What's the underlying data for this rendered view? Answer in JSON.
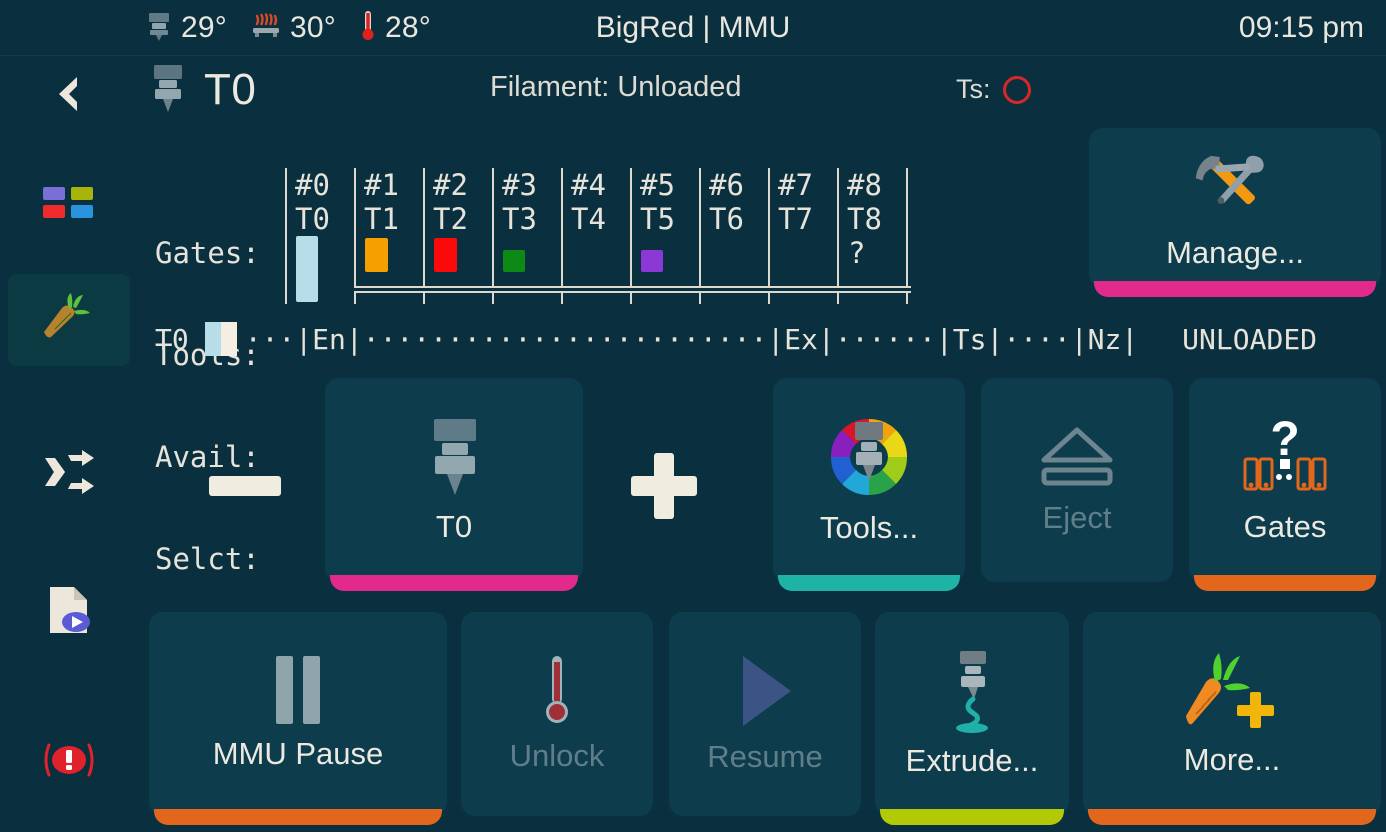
{
  "statusbar": {
    "temps": [
      {
        "icon": "nozzle-icon",
        "value": "29°"
      },
      {
        "icon": "bed-heater-icon",
        "value": "30°"
      },
      {
        "icon": "thermometer-icon",
        "value": "28°"
      }
    ],
    "title": "BigRed | MMU",
    "clock": "09:15 pm"
  },
  "sidebar": {
    "items": [
      {
        "name": "back",
        "icon": "chevron-left-icon",
        "active": false
      },
      {
        "name": "tools",
        "icon": "color-squares-icon",
        "active": false
      },
      {
        "name": "mmu",
        "icon": "carrot-icon",
        "active": true
      },
      {
        "name": "shuffle",
        "icon": "shuffle-icon",
        "active": false
      },
      {
        "name": "print",
        "icon": "file-play-icon",
        "active": false
      },
      {
        "name": "emergency-stop",
        "icon": "emergency-stop-icon",
        "active": false
      }
    ]
  },
  "header": {
    "tool": "T0",
    "tool_icon": "nozzle-icon",
    "filament_status": "Filament: Unloaded",
    "ts_label": "Ts:",
    "ts_state": "open",
    "ts_color": "#d8272a"
  },
  "gates_table": {
    "row_labels": [
      "Gates:",
      "Tools:",
      "Avail:",
      "Selct:"
    ],
    "columns": [
      {
        "gate": "#0",
        "tool": "T0",
        "avail": "swatch",
        "color": "#b6dde8",
        "selected": true
      },
      {
        "gate": "#1",
        "tool": "T1",
        "avail": "swatch",
        "color": "#f5a000",
        "selected": false
      },
      {
        "gate": "#2",
        "tool": "T2",
        "avail": "swatch",
        "color": "#fa0a0a",
        "selected": false
      },
      {
        "gate": "#3",
        "tool": "T3",
        "avail": "swatch-small",
        "color": "#0d8a16",
        "selected": false
      },
      {
        "gate": "#4",
        "tool": "T4",
        "avail": "none",
        "color": "",
        "selected": false
      },
      {
        "gate": "#5",
        "tool": "T5",
        "avail": "swatch-small",
        "color": "#8b38d6",
        "selected": false
      },
      {
        "gate": "#6",
        "tool": "T6",
        "avail": "none",
        "color": "",
        "selected": false
      },
      {
        "gate": "#7",
        "tool": "T7",
        "avail": "none",
        "color": "",
        "selected": false
      },
      {
        "gate": "#8",
        "tool": "T8",
        "avail": "unknown",
        "color": "",
        "selected": false,
        "unknown_glyph": "?"
      }
    ]
  },
  "filament_path": {
    "tool": "T0",
    "swatch_left_color": "#b6dde8",
    "swatch_right_color": "#f4efe2",
    "segments": "···|En|························|Ex|······|Ts|····|Nz|",
    "state": "UNLOADED"
  },
  "buttons": {
    "manage": {
      "label": "Manage...",
      "icon": "hammer-wrench-icon",
      "accent": "#e22a8d",
      "enabled": true
    },
    "minus": {
      "label": "−",
      "icon": "minus-icon",
      "accent": "",
      "enabled": true
    },
    "t0": {
      "label": "T0",
      "icon": "nozzle-icon",
      "accent": "#e22a8d",
      "enabled": true
    },
    "plus": {
      "label": "+",
      "icon": "plus-icon",
      "accent": "",
      "enabled": true
    },
    "tools": {
      "label": "Tools...",
      "icon": "color-wheel-nozzle-icon",
      "accent": "#1fb3a6",
      "enabled": true
    },
    "eject": {
      "label": "Eject",
      "icon": "eject-icon",
      "accent": "",
      "enabled": false
    },
    "gates": {
      "label": "Gates",
      "icon": "gates-question-icon",
      "accent": "#e2671c",
      "enabled": true
    },
    "pause": {
      "label": "MMU Pause",
      "icon": "pause-icon",
      "accent": "#e2671c",
      "enabled": true
    },
    "unlock": {
      "label": "Unlock",
      "icon": "thermometer-icon",
      "accent": "",
      "enabled": false
    },
    "resume": {
      "label": "Resume",
      "icon": "play-icon",
      "accent": "",
      "enabled": false
    },
    "extrude": {
      "label": "Extrude...",
      "icon": "extrude-icon",
      "accent": "#b2c906",
      "enabled": true
    },
    "more": {
      "label": "More...",
      "icon": "carrot-plus-icon",
      "accent": "#e2671c",
      "enabled": true
    }
  }
}
